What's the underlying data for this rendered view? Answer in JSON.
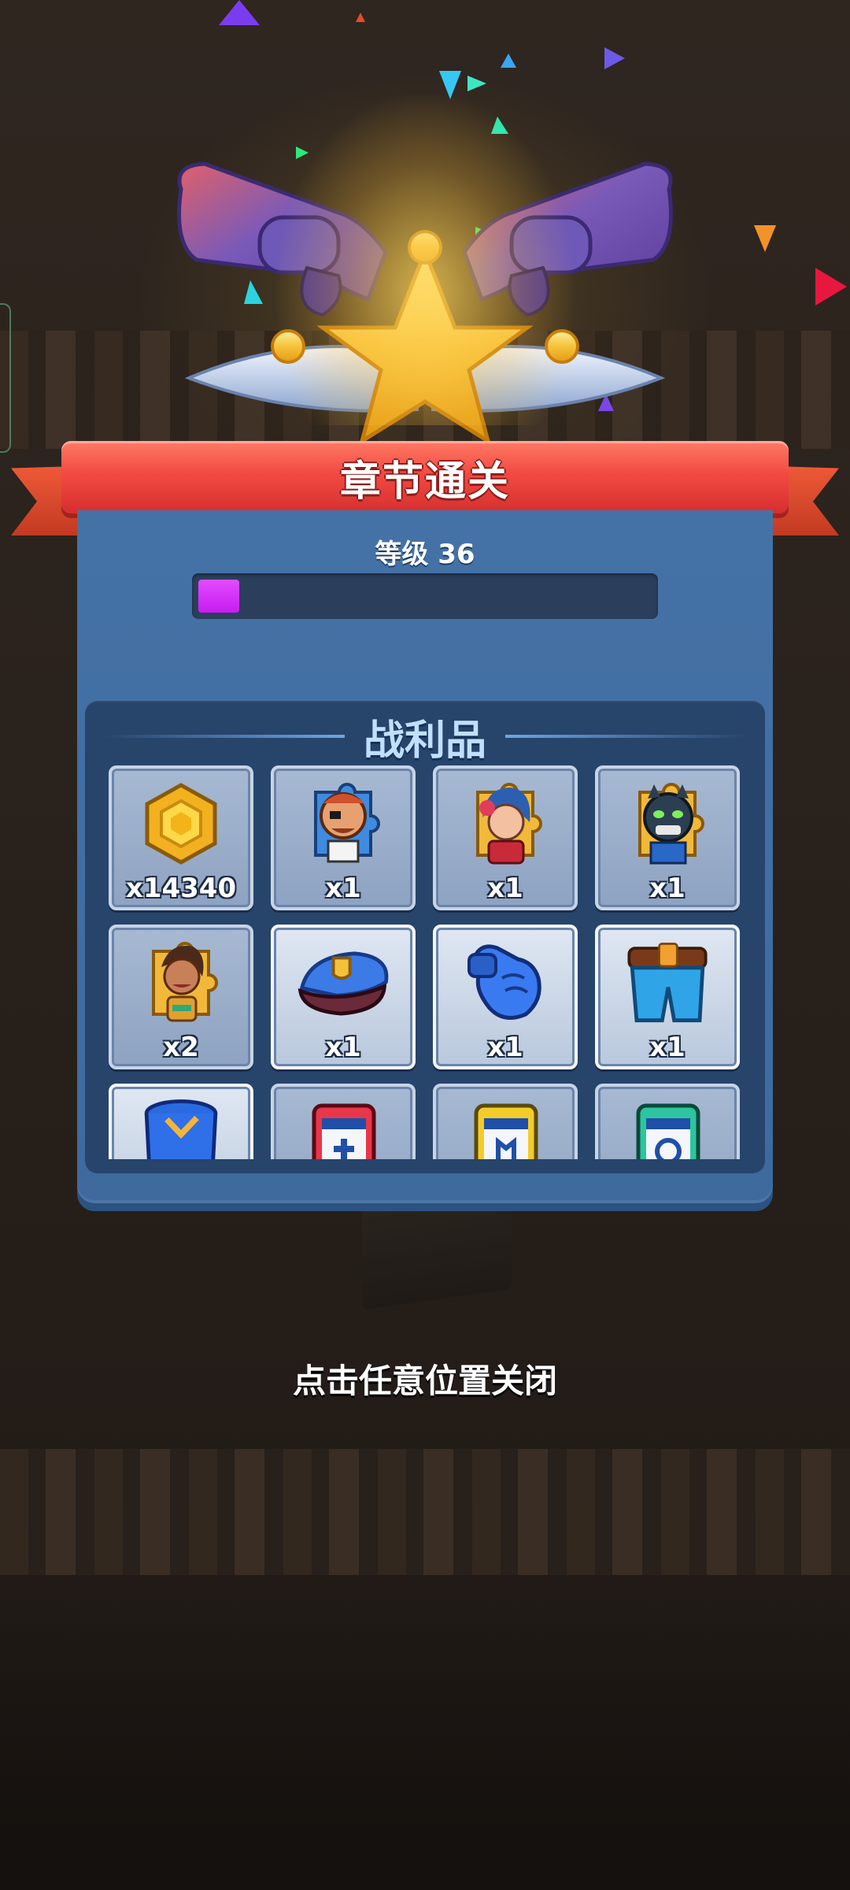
{
  "header": {
    "title": "章节通关"
  },
  "progress": {
    "level_label": "等级 36",
    "xp_fraction": 0.09
  },
  "loot": {
    "title": "战利品",
    "items": [
      {
        "icon": "gold-coin-icon",
        "quantity": "x14340",
        "style": "normal"
      },
      {
        "icon": "hero-puzzle-pirate-icon",
        "quantity": "x1",
        "style": "normal"
      },
      {
        "icon": "hero-puzzle-red-hair-icon",
        "quantity": "x1",
        "style": "normal"
      },
      {
        "icon": "hero-puzzle-panther-icon",
        "quantity": "x1",
        "style": "normal"
      },
      {
        "icon": "hero-puzzle-warrior-icon",
        "quantity": "x2",
        "style": "normal"
      },
      {
        "icon": "police-cap-icon",
        "quantity": "x1",
        "style": "rare"
      },
      {
        "icon": "blue-glove-icon",
        "quantity": "x1",
        "style": "rare"
      },
      {
        "icon": "pants-icon",
        "quantity": "x1",
        "style": "rare"
      },
      {
        "icon": "blue-jar-icon",
        "quantity": "",
        "style": "rare"
      },
      {
        "icon": "red-card-icon",
        "quantity": "",
        "style": "normal"
      },
      {
        "icon": "yellow-card-icon",
        "quantity": "",
        "style": "normal"
      },
      {
        "icon": "green-card-icon",
        "quantity": "",
        "style": "normal"
      }
    ]
  },
  "footer": {
    "close_hint": "点击任意位置关闭"
  },
  "colors": {
    "xp_fill": "#c71cf0",
    "panel": "#4572a6",
    "ribbon": "#f24a43"
  }
}
